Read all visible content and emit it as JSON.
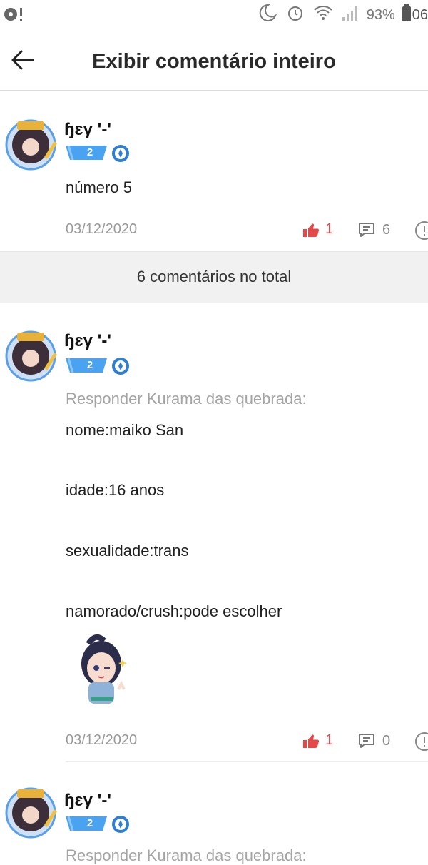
{
  "status_bar": {
    "battery": "93%",
    "time": "06"
  },
  "header": {
    "title": "Exibir comentário inteiro"
  },
  "main_comment": {
    "username": "ɧɛγ '-'",
    "level": "2",
    "text": "número 5",
    "date": "03/12/2020",
    "likes": "1",
    "replies": "6"
  },
  "total_bar": {
    "label": "6 comentários no total"
  },
  "replies": [
    {
      "username": "ɧɛγ '-'",
      "level": "2",
      "reply_to": "Responder Kurama das quebrada:",
      "lines": [
        "nome:maiko San",
        "idade:16 anos",
        "sexualidade:trans",
        "namorado/crush:pode escolher"
      ],
      "date": "03/12/2020",
      "likes": "1",
      "replies": "0"
    },
    {
      "username": "ɧɛγ '-'",
      "level": "2",
      "reply_to": "Responder Kurama das quebrada:"
    }
  ],
  "colors": {
    "accent_like": "#e54848",
    "level_badge": "#4aa3f0",
    "muted": "#9a9a9a"
  }
}
